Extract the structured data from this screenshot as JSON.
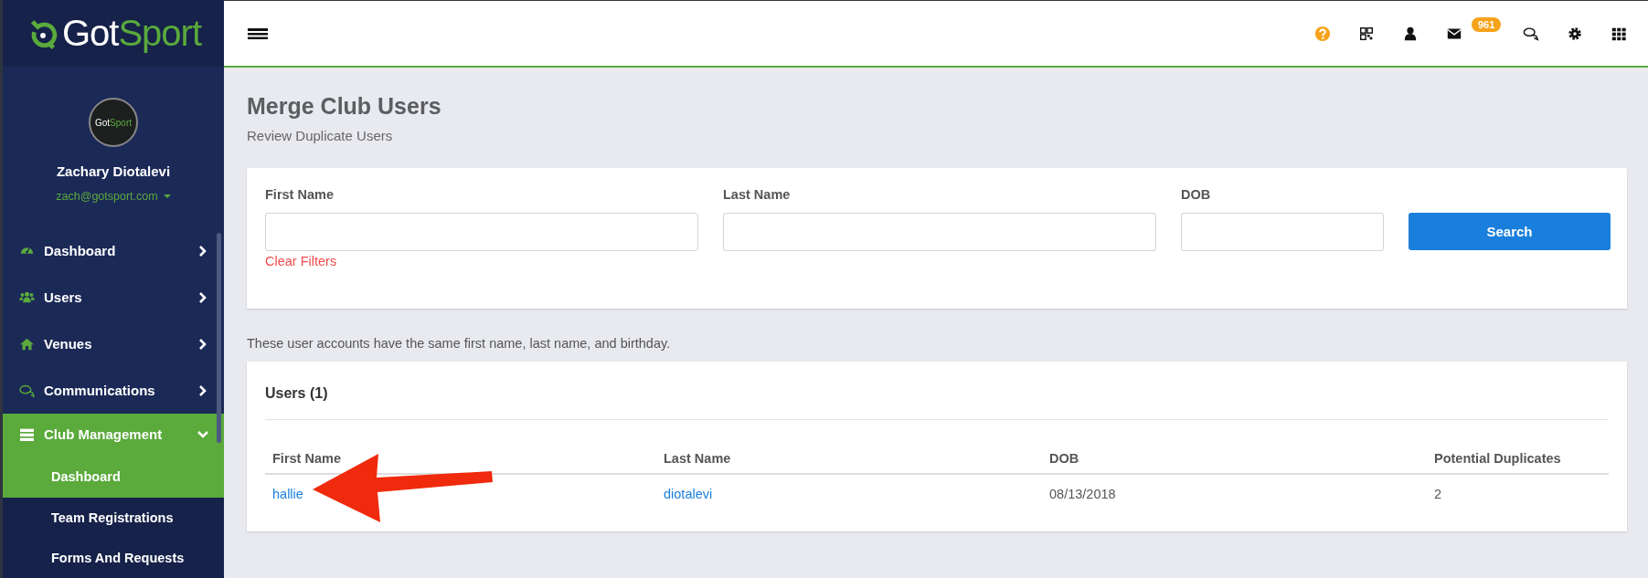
{
  "sidebar": {
    "logo_parts": [
      "Got",
      "Sport"
    ],
    "avatar_parts": [
      "Got",
      "Sport"
    ],
    "user_name": "Zachary Diotalevi",
    "user_email": "zach@gotsport.com",
    "items": [
      {
        "label": "Dashboard",
        "kind": "gauge",
        "expanded": false
      },
      {
        "label": "Users",
        "kind": "users",
        "expanded": false
      },
      {
        "label": "Venues",
        "kind": "home",
        "expanded": false
      },
      {
        "label": "Communications",
        "kind": "chat",
        "expanded": false
      },
      {
        "label": "Club Management",
        "kind": "server",
        "expanded": true,
        "children": [
          {
            "label": "Dashboard",
            "selected": true
          },
          {
            "label": "Team Registrations",
            "selected": false
          },
          {
            "label": "Forms And Requests",
            "selected": false
          }
        ]
      }
    ]
  },
  "topbar": {
    "icons": [
      {
        "kind": "help"
      },
      {
        "kind": "qr"
      },
      {
        "kind": "user"
      },
      {
        "kind": "mail",
        "badge": "961"
      },
      {
        "kind": "chat"
      },
      {
        "kind": "gear"
      },
      {
        "kind": "grid"
      }
    ]
  },
  "page": {
    "title": "Merge Club Users",
    "subtitle": "Review Duplicate Users"
  },
  "filters": {
    "fields": [
      {
        "label": "First Name",
        "kind": "wide"
      },
      {
        "label": "Last Name",
        "kind": "wide"
      },
      {
        "label": "DOB",
        "kind": "narrow"
      }
    ],
    "clear_link": "Clear Filters",
    "button": "Search"
  },
  "note": "These user accounts have the same first name, last name, and birthday.",
  "users": {
    "title": "Users (1)",
    "columns": [
      "First Name",
      "Last Name",
      "DOB",
      "Potential Duplicates"
    ],
    "rows": [
      [
        {
          "text": "hallie",
          "kind": "link"
        },
        {
          "text": "diotalevi",
          "kind": "link"
        },
        {
          "text": "08/13/2018",
          "kind": "plain"
        },
        {
          "text": "2",
          "kind": "plain"
        }
      ]
    ]
  },
  "annotations": [
    {
      "kind": "arrow"
    }
  ]
}
